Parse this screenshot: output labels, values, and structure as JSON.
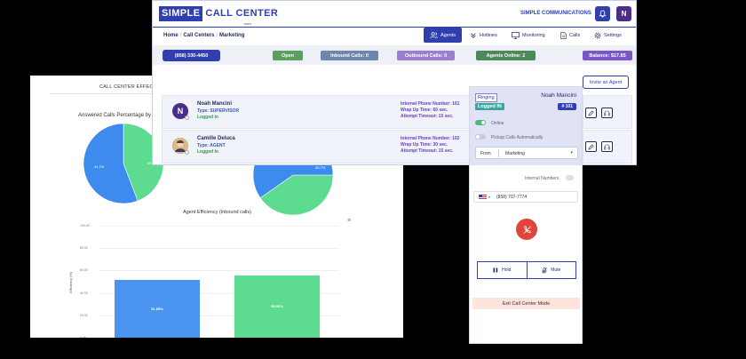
{
  "analytics": {
    "title": "CALL CENTER EFFECIENCY",
    "pie_title": "Answered Calls Percentage by Age",
    "bar_title": "Agent Efficiency (Inbound calls)",
    "menu_glyph": "≡",
    "ylabel": "Efficiency (%)",
    "pie1_labels": [
      "44.2%",
      "55.8%"
    ],
    "pie2_label": "59.7%"
  },
  "chart_data": [
    {
      "type": "pie",
      "title": "Answered Calls Percentage by Age",
      "values": [
        44.2,
        55.8
      ],
      "colors": [
        "#5ddb90",
        "#3d8bef"
      ]
    },
    {
      "type": "pie",
      "title": "",
      "values": [
        40.3,
        59.7
      ],
      "colors": [
        "#5ddb90",
        "#3d8bef"
      ]
    },
    {
      "type": "bar",
      "title": "Agent Efficiency (Inbound calls)",
      "ylabel": "Efficiency (%)",
      "ylim": [
        0,
        100
      ],
      "yticks": [
        "100.00",
        "80.00",
        "60.00",
        "40.00",
        "20.00",
        "0.00"
      ],
      "values": [
        51.85,
        55.56
      ],
      "labels": [
        "51.85%",
        "55.56%"
      ],
      "colors": [
        "#4a94ef",
        "#5ddb90"
      ]
    }
  ],
  "app": {
    "logo_a": "SIMPLE",
    "logo_b": "CALL CENTER",
    "logo_sub": ".com",
    "company": "SIMPLE COMMUNICATIONS",
    "user_initial": "N",
    "breadcrumb": [
      "Home",
      "Call Centers",
      "Marketing"
    ],
    "nav": {
      "agents": "Agents",
      "hotlines": "Hotlines",
      "monitoring": "Monitoring",
      "calls": "Calls",
      "settings": "Settings"
    },
    "status": {
      "phone": "(858) 330-4450",
      "open": "Open",
      "inbound": "Inbound Calls: 0",
      "outbound": "Outbound Calls: 0",
      "online": "Agents Online: 2",
      "balance": "Balance: $17.85"
    },
    "invite": "Invite an Agent",
    "agents": [
      {
        "initial": "N",
        "name": "Noah Mancini",
        "type": "Type: SUPERVISOR",
        "status": "Logged In",
        "ext": "Internal Phone Number: 101",
        "wrap": "Wrap Up Time: 60 sec.",
        "timeout": "Attempt Timeout: 15 sec."
      },
      {
        "initial": "",
        "name": "Camille Deluca",
        "type": "Type: AGENT",
        "status": "Logged In",
        "ext": "Internal Phone Number: 102",
        "wrap": "Wrap Up Time: 30 sec.",
        "timeout": "Attempt Timeout: 15 sec."
      }
    ]
  },
  "phone": {
    "ringing": "Ringing",
    "logged_in": "Logged IN",
    "name": "Noah Mancini",
    "ext": "# 101",
    "online": "Online",
    "pickup": "Pickup Calls Automatically",
    "from_label": "From",
    "from_value": "Marketing",
    "internal": "Internal Numbers",
    "number": "(858) 707-7774",
    "hold": "Hold",
    "mute": "Mute",
    "exit": "Exit Call Center Mode"
  }
}
